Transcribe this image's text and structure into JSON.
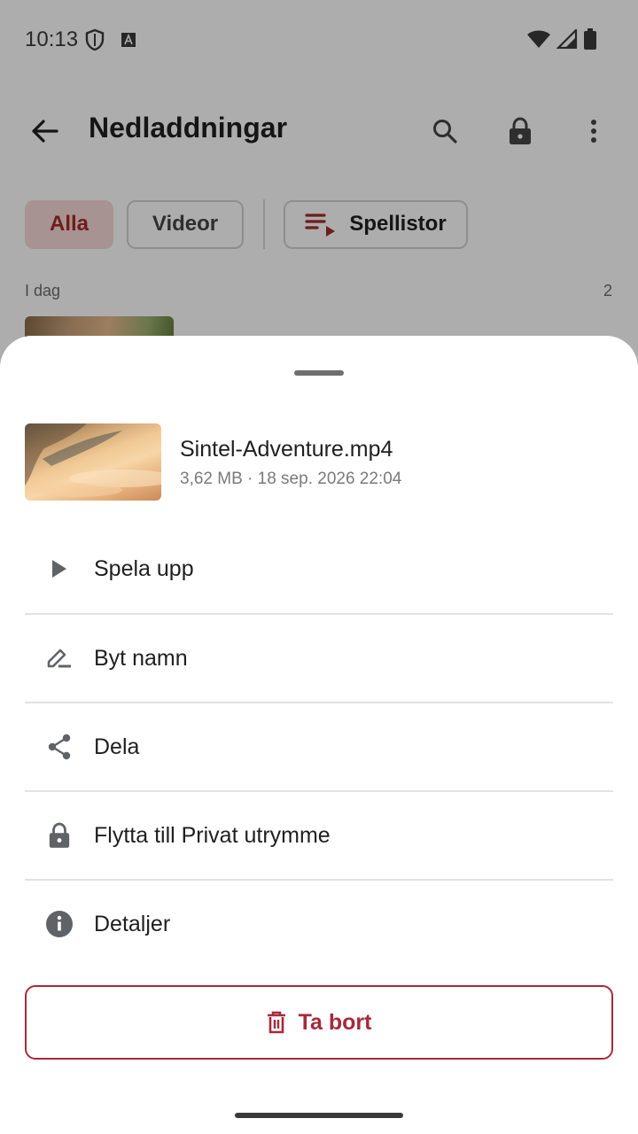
{
  "status_bar": {
    "time": "10:13",
    "left_icons": [
      "shield-icon",
      "a-badge-icon"
    ],
    "right_icons": [
      "wifi-icon",
      "signal-icon",
      "battery-icon"
    ]
  },
  "app_bar": {
    "title": "Nedladdningar",
    "actions": [
      "search-icon",
      "lock-icon",
      "more-vert-icon"
    ]
  },
  "filters": {
    "all": "Alla",
    "videos": "Videor",
    "playlists": "Spellistor"
  },
  "list": {
    "section_label": "I dag",
    "section_count": "2"
  },
  "sheet": {
    "file": {
      "name": "Sintel-Adventure.mp4",
      "meta": "3,62 MB · 18 sep. 2026 22:04"
    },
    "menu": [
      {
        "label": "Spela upp",
        "icon": "play-icon"
      },
      {
        "label": "Byt namn",
        "icon": "rename-pen-icon"
      },
      {
        "label": "Dela",
        "icon": "share-icon"
      },
      {
        "label": "Flytta till Privat utrymme",
        "icon": "lock-icon"
      },
      {
        "label": "Detaljer",
        "icon": "info-icon"
      }
    ],
    "delete_label": "Ta bort"
  },
  "colors": {
    "accent": "#a52a3a",
    "chip_selected_bg": "#f6d9d6",
    "icon_gray": "#5f6368"
  }
}
